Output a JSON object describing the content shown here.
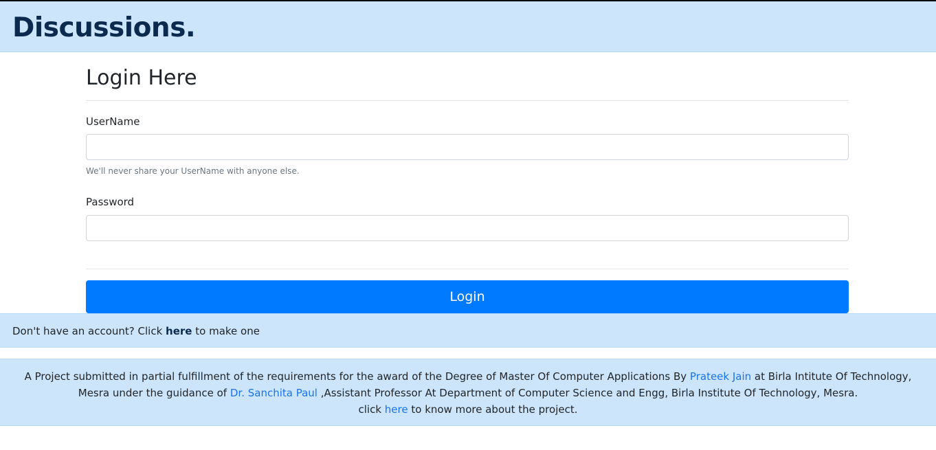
{
  "navbar": {
    "brand": "Discussions."
  },
  "login_form": {
    "title": "Login Here",
    "username": {
      "label": "UserName",
      "value": "",
      "placeholder": "",
      "help": "We'll never share your UserName with anyone else."
    },
    "password": {
      "label": "Password",
      "value": "",
      "placeholder": ""
    },
    "submit_label": "Login"
  },
  "signup": {
    "prefix": "Don't have an account? Click ",
    "link": "here",
    "suffix": " to make one"
  },
  "footer": {
    "t1": "A Project submitted in partial fulfillment of the requirements for the award of the Degree of Master Of Computer Applications By ",
    "author": "Prateek Jain",
    "t2": " at Birla Intitute Of Technology, Mesra under the guidance of ",
    "guide": "Dr. Sanchita Paul",
    "t3": " ,Assistant Professor At Department of Computer Science and Engg, Birla Institute Of Technology, Mesra.",
    "t4": "click ",
    "more_link": "here",
    "t5": " to know more about the project."
  },
  "colors": {
    "bar_background": "#cce5fb",
    "brand": "#0b2a4e",
    "primary_button": "#007bff",
    "link": "#1a73e8"
  }
}
